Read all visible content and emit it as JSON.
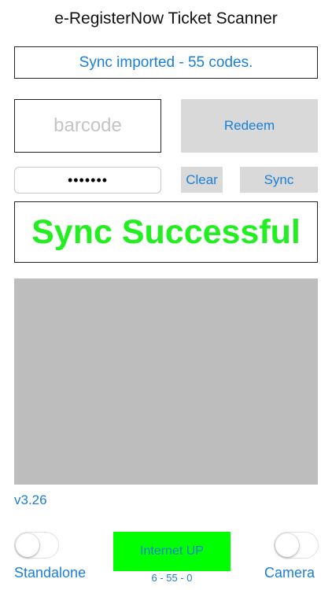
{
  "app": {
    "title": "e-RegisterNow Ticket Scanner"
  },
  "status": {
    "message": "Sync imported - 55 codes."
  },
  "barcode": {
    "placeholder": "barcode",
    "value": ""
  },
  "buttons": {
    "redeem": "Redeem",
    "clear": "Clear",
    "sync": "Sync"
  },
  "password": {
    "masked_value": "•••••••"
  },
  "result": {
    "message": "Sync Successful"
  },
  "footer": {
    "version": "v3.26",
    "standalone_label": "Standalone",
    "standalone_on": false,
    "camera_label": "Camera",
    "camera_on": false,
    "internet_status": "Internet UP",
    "counts": "6 - 55 - 0"
  },
  "colors": {
    "accent": "#1a7fd6",
    "success_text": "#22ee22",
    "internet_bg": "#00ff00",
    "button_bg": "#d9d9d9",
    "camera_preview_bg": "#bdbdbd"
  }
}
